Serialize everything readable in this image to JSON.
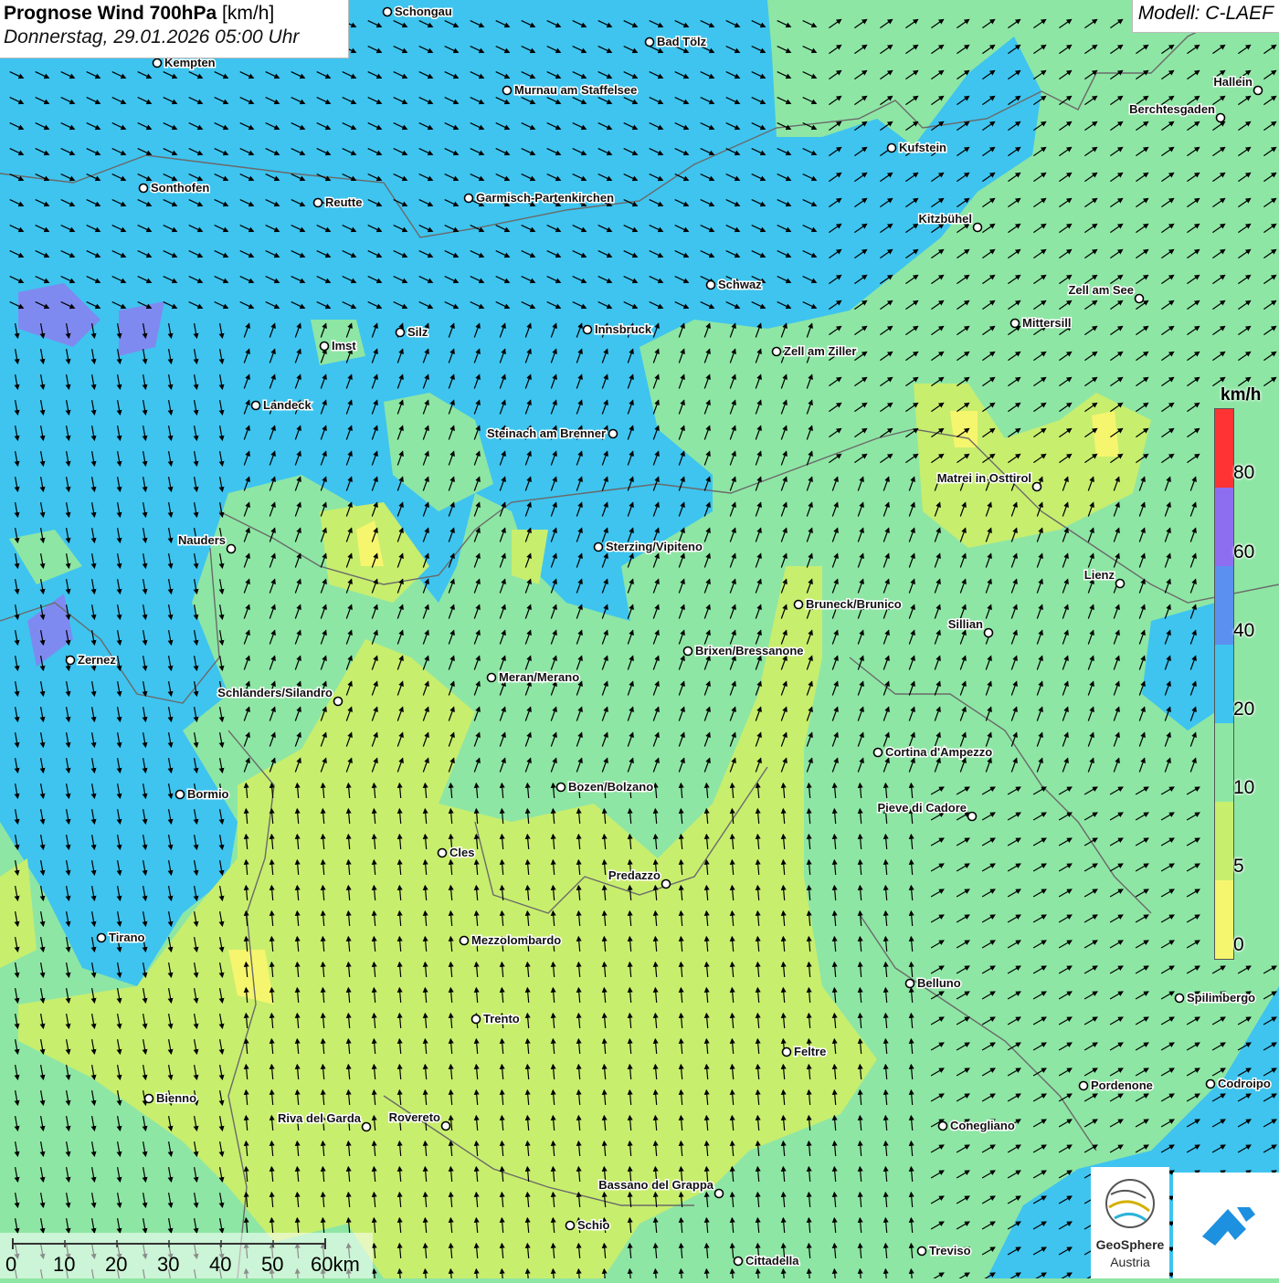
{
  "title": {
    "main_bold": "Prognose Wind 700hPa",
    "main_unit": " [km/h]",
    "date": "Donnerstag, 29.01.2026 05:00 Uhr"
  },
  "model_label": "Modell: C-LAEF",
  "wind_direction": "northwest wind over north, southerly/south-westerly over south",
  "legend": {
    "unit": "km/h",
    "ticks": [
      "80",
      "60",
      "40",
      "20",
      "10",
      "5",
      "0"
    ],
    "colors": [
      "#ff3333",
      "#8e6ef0",
      "#5b90f0",
      "#3ec4ef",
      "#8ee6a4",
      "#c8ee6e",
      "#f6f56e"
    ]
  },
  "scale_bar": {
    "labels": [
      "0",
      "10",
      "20",
      "30",
      "40",
      "50",
      "60km"
    ]
  },
  "logo": {
    "line1": "GeoSphere",
    "line2": "Austria"
  },
  "cities": [
    {
      "name": "Schongau"
    },
    {
      "name": "Bad Tölz"
    },
    {
      "name": "Kempten"
    },
    {
      "name": "Murnau am Staffelsee"
    },
    {
      "name": "Hallein"
    },
    {
      "name": "Berchtesgaden"
    },
    {
      "name": "Kufstein"
    },
    {
      "name": "Sonthofen"
    },
    {
      "name": "Reutte"
    },
    {
      "name": "Garmisch-Partenkirchen"
    },
    {
      "name": "Kitzbühel"
    },
    {
      "name": "Schwaz"
    },
    {
      "name": "Zell am See"
    },
    {
      "name": "Innsbruck"
    },
    {
      "name": "Mittersill"
    },
    {
      "name": "Silz"
    },
    {
      "name": "Imst"
    },
    {
      "name": "Zell am Ziller"
    },
    {
      "name": "Landeck"
    },
    {
      "name": "Steinach am Brenner"
    },
    {
      "name": "Matrei in Osttirol"
    },
    {
      "name": "Nauders"
    },
    {
      "name": "Sterzing/Vipiteno"
    },
    {
      "name": "Lienz"
    },
    {
      "name": "Bruneck/Brunico"
    },
    {
      "name": "Sillian"
    },
    {
      "name": "Brixen/Bressanone"
    },
    {
      "name": "Zernez"
    },
    {
      "name": "Meran/Merano"
    },
    {
      "name": "Schlanders/Silandro"
    },
    {
      "name": "Cortina d'Ampezzo"
    },
    {
      "name": "Bormio"
    },
    {
      "name": "Bozen/Bolzano"
    },
    {
      "name": "Pieve di Cadore"
    },
    {
      "name": "Cles"
    },
    {
      "name": "Predazzo"
    },
    {
      "name": "Tirano"
    },
    {
      "name": "Mezzolombardo"
    },
    {
      "name": "Belluno"
    },
    {
      "name": "Spilimbergo"
    },
    {
      "name": "Trento"
    },
    {
      "name": "Feltre"
    },
    {
      "name": "Pordenone"
    },
    {
      "name": "Codroipo"
    },
    {
      "name": "Bienno"
    },
    {
      "name": "Riva del Garda"
    },
    {
      "name": "Rovereto"
    },
    {
      "name": "Conegliano"
    },
    {
      "name": "Bassano del Grappa"
    },
    {
      "name": "Schio"
    },
    {
      "name": "Treviso"
    },
    {
      "name": "Cittadella"
    }
  ]
}
